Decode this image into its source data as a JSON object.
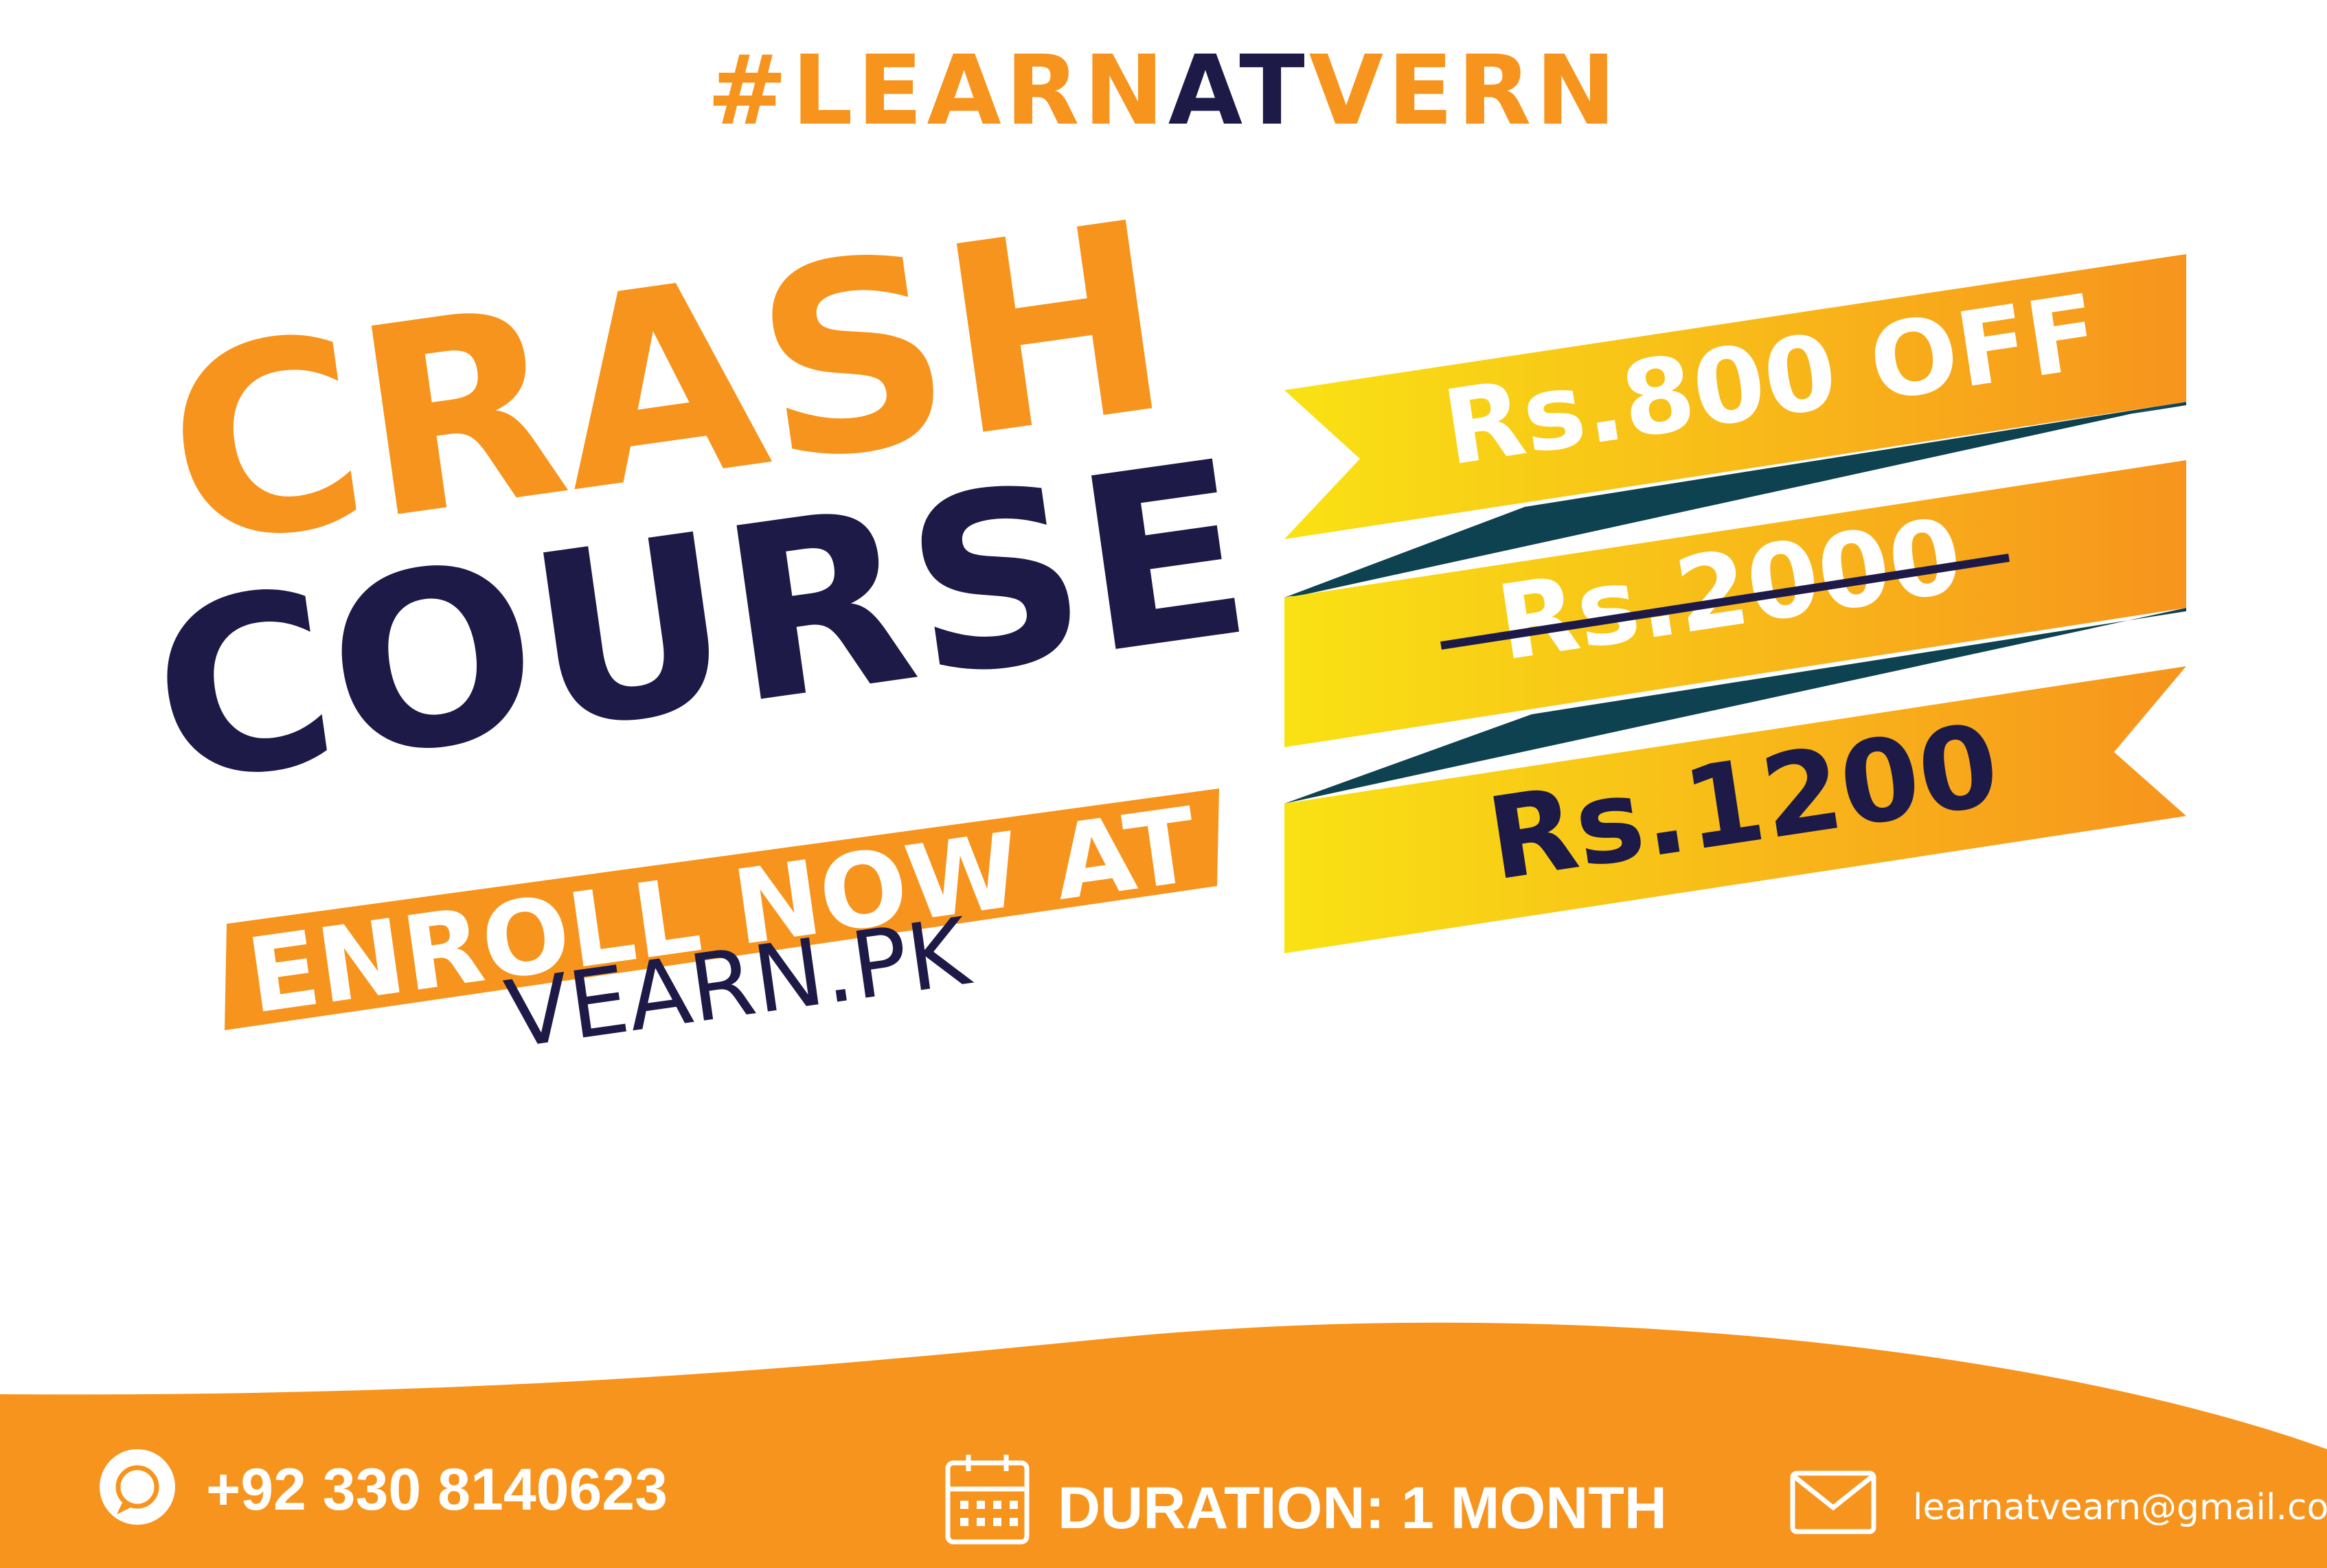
{
  "hashtag": {
    "part1": "#LEARN",
    "part2": "AT",
    "part3": "VERN"
  },
  "headline": {
    "line1": "CRASH",
    "line2": "COURSE"
  },
  "enroll": {
    "label": "ENROLL NOW AT",
    "website": "VEARN.PK"
  },
  "pricing": {
    "discount": "Rs.800 OFF",
    "original_price": "Rs.2000",
    "final_price": "Rs.1200"
  },
  "footer": {
    "phone_icon": "whatsapp-icon",
    "phone": "+92 330 8140623",
    "duration_icon": "calendar-icon",
    "duration": "DURATION: 1 MONTH",
    "email_icon": "envelope-icon",
    "email": "learnatvearn@gmail.com"
  },
  "colors": {
    "orange": "#F7941D",
    "navy": "#1E1A47",
    "yellow": "#F9E214",
    "teal": "#0F4250",
    "white": "#FFFFFF"
  }
}
